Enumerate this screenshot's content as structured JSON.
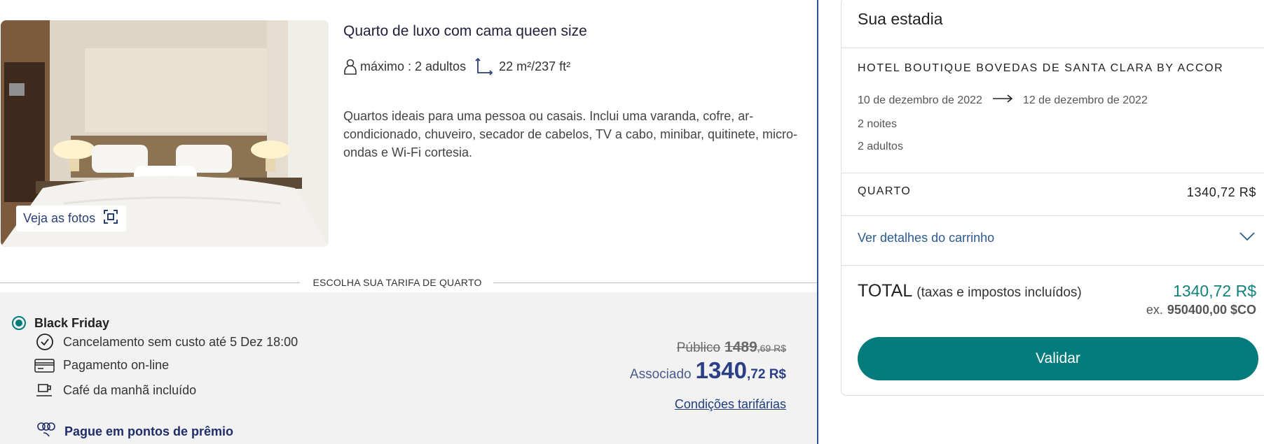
{
  "room": {
    "title": "Quarto de luxo com cama queen size",
    "capacity": "máximo : 2 adultos",
    "area": "22 m²/237 ft²",
    "description": "Quartos ideais para uma pessoa ou casais. Inclui uma varanda, cofre, ar-condicionado, chuveiro, secador de cabelos, TV a cabo, minibar, quitinete, micro-ondas e Wi-Fi cortesia.",
    "photos_button": "Veja as fotos"
  },
  "rate_section": {
    "heading": "ESCOLHA SUA TARIFA DE QUARTO"
  },
  "rate": {
    "name": "Black Friday",
    "features": [
      "Cancelamento sem custo até 5 Dez 18:00",
      "Pagamento on-line",
      "Café da manhã incluído"
    ],
    "points_link": "Pague em pontos de prêmio",
    "public_label": "Público",
    "public_int": "1489",
    "public_dec": ",69 R$",
    "member_label": "Associado",
    "member_int": "1340",
    "member_dec": ",72 R$",
    "conditions_link": "Condições tarifárias",
    "selected": true
  },
  "stay": {
    "title": "Sua estadia",
    "hotel": "HOTEL BOUTIQUE BOVEDAS DE SANTA CLARA BY ACCOR",
    "checkin": "10 de dezembro de 2022",
    "checkout": "12 de dezembro de 2022",
    "nights": "2 noites",
    "adults": "2 adultos",
    "room_label": "QUARTO",
    "room_price": "1340,72 R$",
    "cart_details": "Ver detalhes do carrinho",
    "total_label": "TOTAL",
    "total_note": "(taxas e impostos incluídos)",
    "total_value": "1340,72 R$",
    "ex_label": "ex.",
    "ex_value": "950400,00 $CO",
    "validate_button": "Validar"
  },
  "colors": {
    "accent_teal": "#047c7c",
    "price_blue": "#2a3f86",
    "link_blue": "#2d5a8f"
  },
  "icons": [
    "person-icon",
    "area-icon",
    "fullscreen-icon",
    "clock-icon",
    "card-icon",
    "cup-icon",
    "points-icon",
    "arrow-right-icon",
    "chevron-down-icon"
  ]
}
